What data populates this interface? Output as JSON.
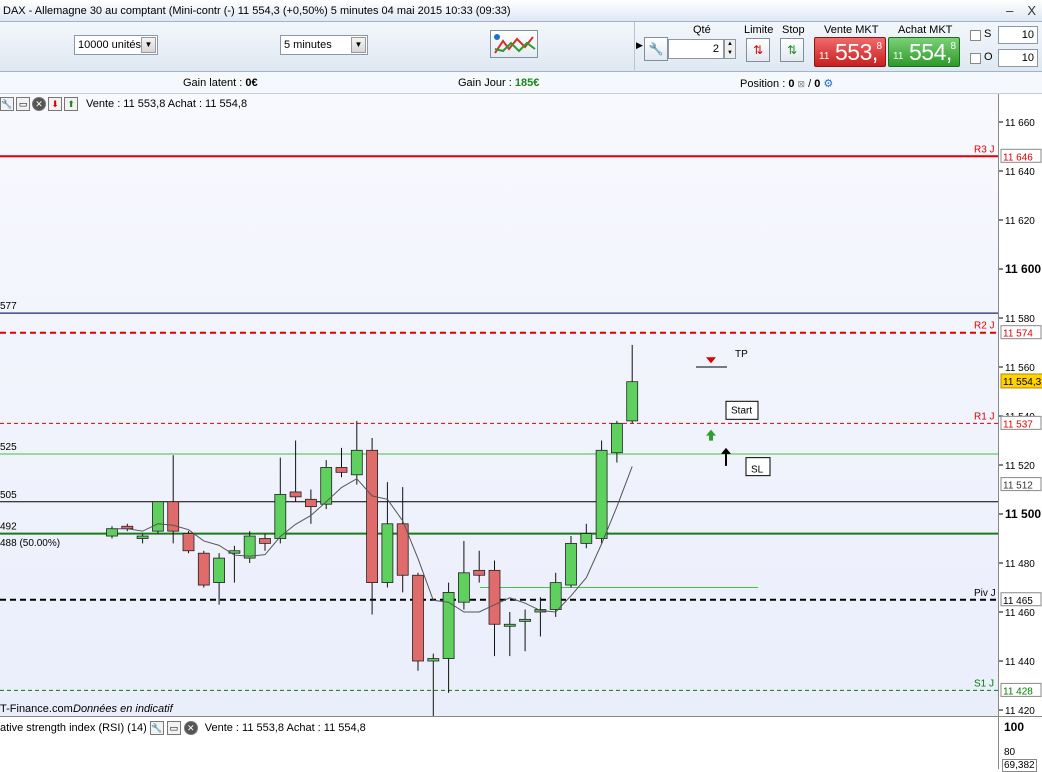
{
  "window": {
    "title": "DAX - Allemagne 30 au comptant (Mini-contr (-)   11 554,3 (+0,50%)     5 minutes   04 mai 2015 10:33 (09:33)",
    "minimize": "–",
    "close": "X"
  },
  "toolbar": {
    "lot_select": "10000 unités",
    "period_select": "5 minutes",
    "qty_label": "Qté",
    "qty_value": "2",
    "limit_label": "Limite",
    "stop_label": "Stop",
    "sell_label": "Vente MKT",
    "buy_label": "Achat MKT",
    "sell_price": {
      "prefix": "11",
      "main": "553,",
      "sup": "8"
    },
    "buy_price": {
      "prefix": "11",
      "main": "554,",
      "sup": "8"
    },
    "s_label": "S",
    "o_label": "O",
    "s_value": "10",
    "o_value": "10"
  },
  "infobar": {
    "latent_label": "Gain latent :",
    "latent_value": "0€",
    "day_label": "Gain Jour :",
    "day_value": "185€",
    "position_label": "Position :",
    "position_value": "0",
    "position_sep": "/",
    "position_value2": "0"
  },
  "chart_header": {
    "quote": "Vente : 11 553,8 Achat : 11 554,8"
  },
  "chart_data": {
    "type": "candlestick",
    "ylim": [
      11410,
      11670
    ],
    "yticks": [
      "11 660",
      "11 640",
      "11 620",
      "11 600",
      "11 580",
      "11 560",
      "11 540",
      "11 520",
      "11 500",
      "11 480",
      "11 460",
      "11 440",
      "11 420"
    ],
    "bold_ticks": [
      "11 600",
      "11 500"
    ],
    "current_price": "11 554,3",
    "levels": [
      {
        "name": "R3 J",
        "value": "11 646",
        "color": "#e00000",
        "style": "solid"
      },
      {
        "name": "R2 J",
        "value": "11 574",
        "color": "#e00000",
        "style": "dashed"
      },
      {
        "name": "R1 J",
        "value": "11 537",
        "color": "#e00000",
        "style": "dashed-thin"
      },
      {
        "name": "Piv J",
        "value": "11 465",
        "color": "#000000",
        "style": "dashed"
      },
      {
        "name": "S1 J",
        "value": "11 428",
        "color": "#008000",
        "style": "dashed-thin"
      }
    ],
    "extra_right_labels": [
      "11 512"
    ],
    "left_labels": [
      "577",
      "525",
      "505",
      "492",
      "488 (50.00%)"
    ],
    "annotations": [
      "TP",
      "Start",
      "SL"
    ],
    "candles": [
      {
        "o": 11491,
        "c": 11494,
        "h": 11495,
        "l": 11490
      },
      {
        "o": 11495,
        "c": 11494,
        "h": 11496,
        "l": 11493
      },
      {
        "o": 11490,
        "c": 11491,
        "h": 11492,
        "l": 11488
      },
      {
        "o": 11493,
        "c": 11505,
        "h": 11505,
        "l": 11492
      },
      {
        "o": 11505,
        "c": 11493,
        "h": 11524,
        "l": 11488
      },
      {
        "o": 11492,
        "c": 11485,
        "h": 11493,
        "l": 11484
      },
      {
        "o": 11484,
        "c": 11471,
        "h": 11485,
        "l": 11470
      },
      {
        "o": 11472,
        "c": 11482,
        "h": 11484,
        "l": 11463
      },
      {
        "o": 11484,
        "c": 11485,
        "h": 11487,
        "l": 11472
      },
      {
        "o": 11482,
        "c": 11491,
        "h": 11493,
        "l": 11480
      },
      {
        "o": 11490,
        "c": 11488,
        "h": 11492,
        "l": 11485
      },
      {
        "o": 11490,
        "c": 11508,
        "h": 11523,
        "l": 11488
      },
      {
        "o": 11509,
        "c": 11507,
        "h": 11530,
        "l": 11505
      },
      {
        "o": 11506,
        "c": 11503,
        "h": 11510,
        "l": 11496
      },
      {
        "o": 11504,
        "c": 11519,
        "h": 11522,
        "l": 11502
      },
      {
        "o": 11519,
        "c": 11517,
        "h": 11527,
        "l": 11515
      },
      {
        "o": 11516,
        "c": 11526,
        "h": 11538,
        "l": 11512
      },
      {
        "o": 11526,
        "c": 11472,
        "h": 11531,
        "l": 11459
      },
      {
        "o": 11472,
        "c": 11496,
        "h": 11513,
        "l": 11470
      },
      {
        "o": 11496,
        "c": 11475,
        "h": 11511,
        "l": 11468
      },
      {
        "o": 11475,
        "c": 11440,
        "h": 11476,
        "l": 11436
      },
      {
        "o": 11440,
        "c": 11441,
        "h": 11443,
        "l": 11413
      },
      {
        "o": 11441,
        "c": 11468,
        "h": 11472,
        "l": 11427
      },
      {
        "o": 11464,
        "c": 11476,
        "h": 11489,
        "l": 11461
      },
      {
        "o": 11477,
        "c": 11475,
        "h": 11485,
        "l": 11472
      },
      {
        "o": 11477,
        "c": 11455,
        "h": 11481,
        "l": 11442
      },
      {
        "o": 11455,
        "c": 11455,
        "h": 11460,
        "l": 11442
      },
      {
        "o": 11457,
        "c": 11457,
        "h": 11461,
        "l": 11444
      },
      {
        "o": 11460,
        "c": 11461,
        "h": 11466,
        "l": 11450
      },
      {
        "o": 11461,
        "c": 11472,
        "h": 11476,
        "l": 11458
      },
      {
        "o": 11471,
        "c": 11488,
        "h": 11491,
        "l": 11470
      },
      {
        "o": 11488,
        "c": 11492,
        "h": 11496,
        "l": 11486
      },
      {
        "o": 11490,
        "c": 11526,
        "h": 11530,
        "l": 11488
      },
      {
        "o": 11525,
        "c": 11537,
        "h": 11538,
        "l": 11521
      },
      {
        "o": 11538,
        "c": 11554,
        "h": 11569,
        "l": 11537
      }
    ]
  },
  "footer_note": "T-Finance.com",
  "footer_note2": "Données en indicatif",
  "rsi": {
    "title": "ative strength index (RSI) (14)",
    "quote": "Vente : 11 553,8 Achat : 11 554,8",
    "tick_top": "100",
    "tick_mid": "80",
    "value": "69,382"
  }
}
